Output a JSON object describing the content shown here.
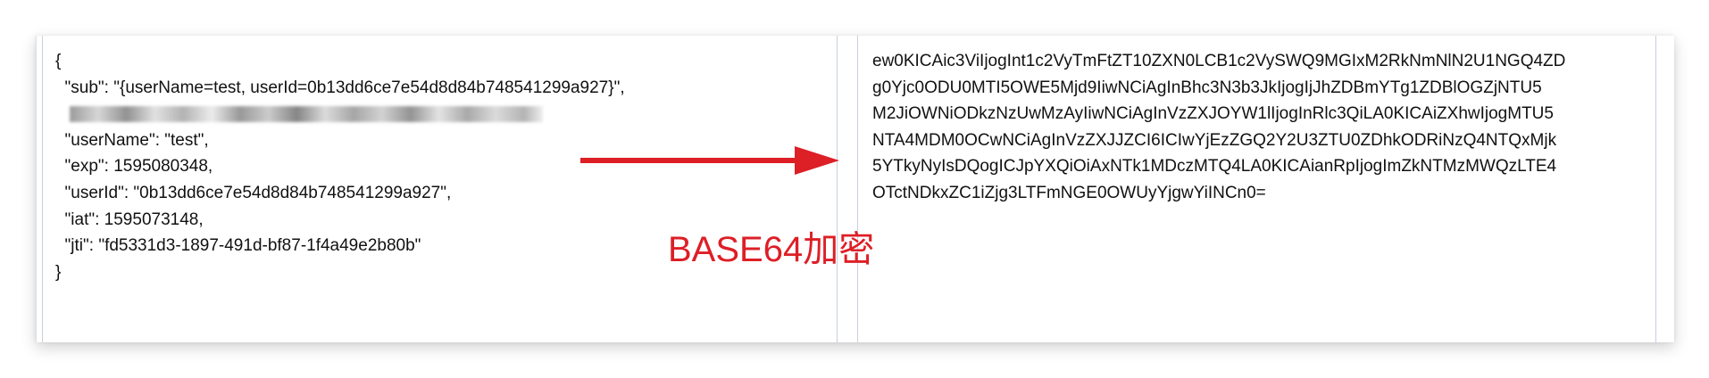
{
  "json_panel": {
    "lines": [
      "{",
      "  \"sub\": \"{userName=test, userId=0b13dd6ce7e54d8d84b748541299a927}\",",
      "",
      "  \"userName\": \"test\",",
      "  \"exp\": 1595080348,",
      "  \"userId\": \"0b13dd6ce7e54d8d84b748541299a927\",",
      "  \"iat\": 1595073148,",
      "  \"jti\": \"fd5331d3-1897-491d-bf87-1f4a49e2b80b\"",
      "}"
    ]
  },
  "encoded_panel": {
    "lines": [
      "ew0KICAic3ViIjogInt1c2VyTmFtZT10ZXN0LCB1c2VySWQ9MGIxM2RkNmNlN2U1NGQ4ZD",
      "g0Yjc0ODU0MTI5OWE5Mjd9IiwNCiAgInBhc3N3b3JkIjogIjJhZDBmYTg1ZDBlOGZjNTU5",
      "M2JiOWNiODkzNzUwMzAyIiwNCiAgInVzZXJOYW1lIjogInRlc3QiLA0KICAiZXhwIjogMTU5",
      "NTA4MDM0OCwNCiAgInVzZXJJZCI6ICIwYjEzZGQ2Y2U3ZTU0ZDhkODRiNzQ4NTQxMjk",
      "5YTkyNyIsDQogICJpYXQiOiAxNTk1MDczMTQ4LA0KICAianRpIjogImZkNTMzMWQzLTE4",
      "OTctNDkxZC1iZjg3LTFmNGE0OWUyYjgwYiINCn0="
    ]
  },
  "annotation": {
    "label": "BASE64加密",
    "color": "#dd1f26"
  }
}
